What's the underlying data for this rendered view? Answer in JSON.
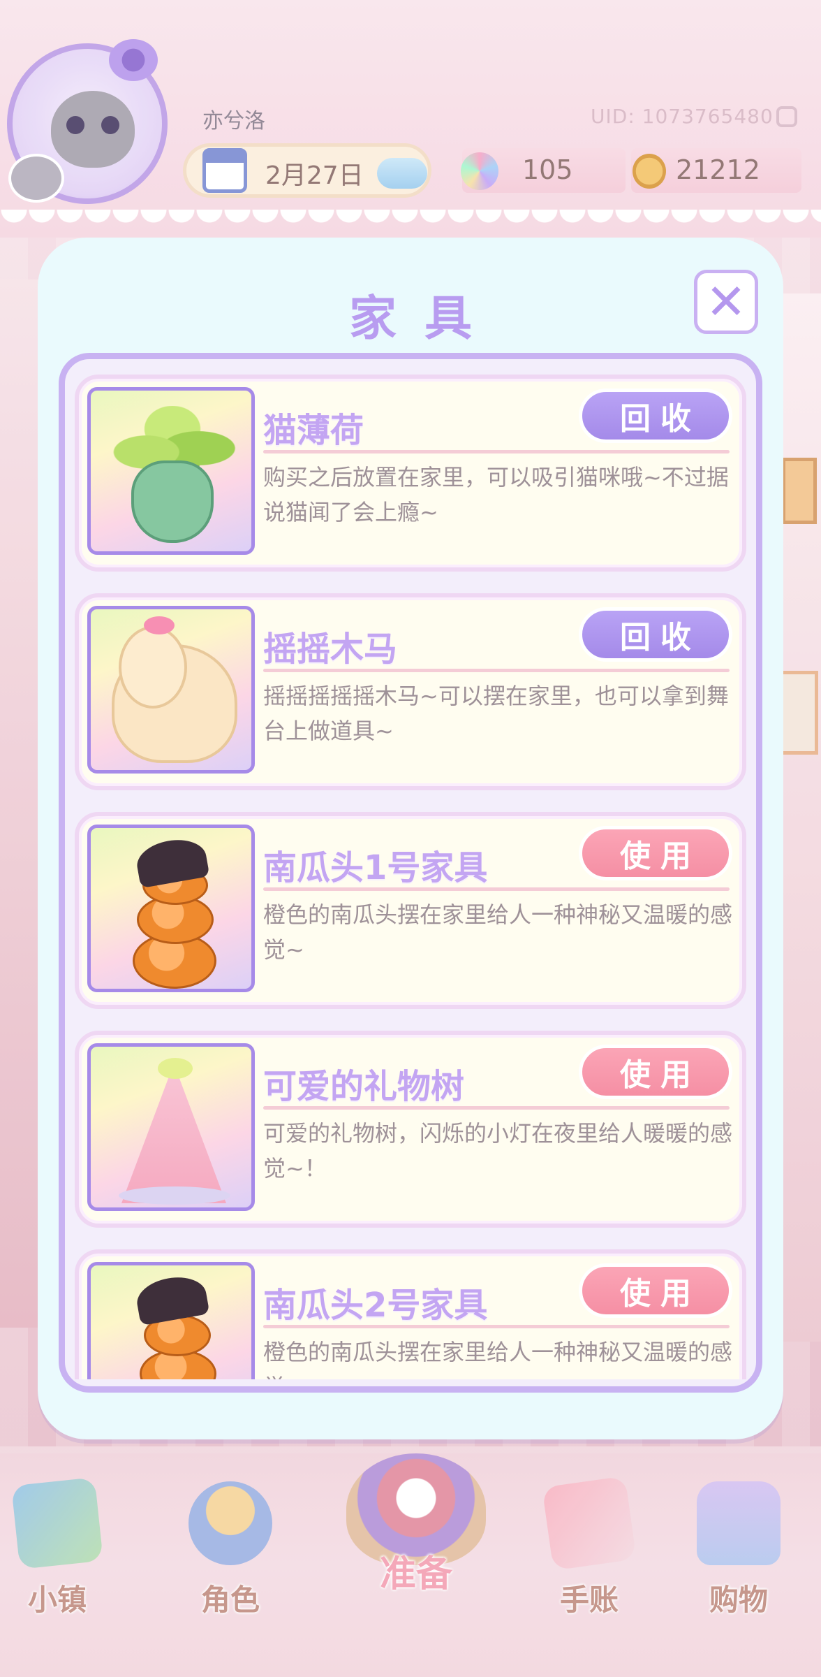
{
  "header": {
    "username": "亦兮洛",
    "uid": "UID: 1073765480",
    "date": "2月27日",
    "flowers": "105",
    "coins": "21212"
  },
  "dialog": {
    "title": "家具",
    "close_symbol": "✕",
    "items": [
      {
        "name": "猫薄荷",
        "desc": "购买之后放置在家里，可以吸引猫咪哦~不过据说猫闻了会上瘾~",
        "action": "回收",
        "action_type": "recycle"
      },
      {
        "name": "摇摇木马",
        "desc": "摇摇摇摇摇木马~可以摆在家里，也可以拿到舞台上做道具~",
        "action": "回收",
        "action_type": "recycle"
      },
      {
        "name": "南瓜头1号家具",
        "desc": "橙色的南瓜头摆在家里给人一种神秘又温暖的感觉~",
        "action": "使用",
        "action_type": "use"
      },
      {
        "name": "可爱的礼物树",
        "desc": "可爱的礼物树，闪烁的小灯在夜里给人暖暖的感觉~！",
        "action": "使用",
        "action_type": "use"
      },
      {
        "name": "南瓜头2号家具",
        "desc": "橙色的南瓜头摆在家里给人一种神秘又温暖的感觉~",
        "action": "使用",
        "action_type": "use"
      }
    ]
  },
  "nav": {
    "town": "小镇",
    "role": "角色",
    "prepare": "准备",
    "diary": "手账",
    "shop": "购物"
  },
  "icons": {
    "avatar": "cat-avatar",
    "calendar": "calendar-icon",
    "weather": "cloud-icon",
    "flower_currency": "flower-icon",
    "coin_currency": "coin-icon"
  },
  "colors": {
    "accent_purple": "#b89cf0",
    "recycle_button": "#a48ae9",
    "use_button": "#f58fa4",
    "card_bg": "#fffdf0",
    "dialog_bg": "#eafafd"
  }
}
